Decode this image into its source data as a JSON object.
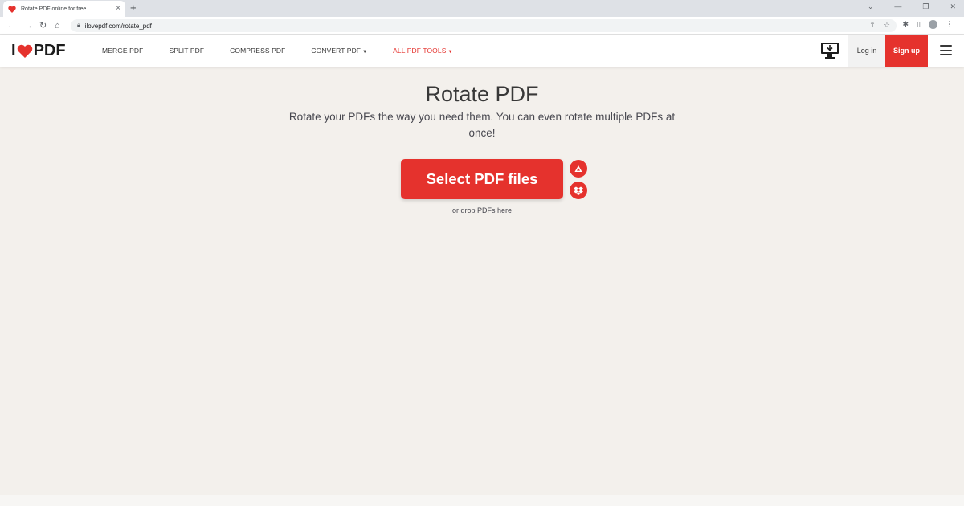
{
  "browser": {
    "tab_title": "Rotate PDF online for free",
    "tab_close": "×",
    "new_tab": "+",
    "url": "ilovepdf.com/rotate_pdf",
    "back": "←",
    "forward": "→",
    "reload": "↻",
    "home": "⌂"
  },
  "header": {
    "logo_left": "I",
    "logo_right": "PDF",
    "nav": [
      {
        "label": "MERGE PDF"
      },
      {
        "label": "SPLIT PDF"
      },
      {
        "label": "COMPRESS PDF"
      },
      {
        "label": "CONVERT PDF"
      },
      {
        "label": "ALL PDF TOOLS"
      }
    ],
    "login_label": "Log in",
    "signup_label": "Sign up"
  },
  "main": {
    "title": "Rotate PDF",
    "subtitle": "Rotate your PDFs the way you need them. You can even rotate multiple PDFs at once!",
    "select_button": "Select PDF files",
    "drop_hint": "or drop PDFs here"
  },
  "colors": {
    "brand_red": "#e5322d",
    "background": "#f3f0ec",
    "text_dark": "#383838"
  },
  "icons": {
    "tab_favicon": "heart-icon",
    "desktop": "desktop-download-icon",
    "google_drive": "google-drive-icon",
    "dropbox": "dropbox-icon",
    "menu": "hamburger-menu-icon"
  }
}
